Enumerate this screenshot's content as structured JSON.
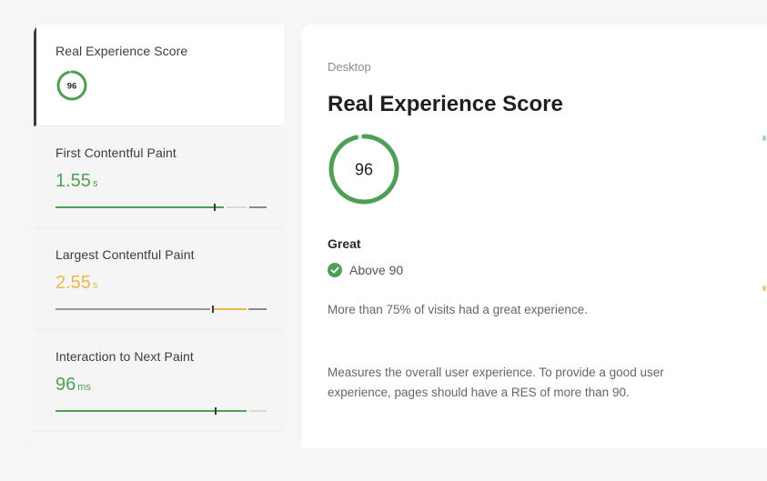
{
  "sidebar": {
    "metrics": [
      {
        "title": "Real Experience Score",
        "score": "96",
        "score_fraction": 0.96,
        "status": "good"
      },
      {
        "title": "First Contentful Paint",
        "value": "1.55",
        "unit": "s",
        "status": "good",
        "marker_fraction": 0.75
      },
      {
        "title": "Largest Contentful Paint",
        "value": "2.55",
        "unit": "s",
        "status": "needs-improvement",
        "marker_fraction": 0.74
      },
      {
        "title": "Interaction to Next Paint",
        "value": "96",
        "unit": "ms",
        "status": "good",
        "marker_fraction": 0.76
      }
    ]
  },
  "main": {
    "device": "Desktop",
    "title": "Real Experience Score",
    "score": "96",
    "score_fraction": 0.96,
    "rating": "Great",
    "threshold": "Above 90",
    "visits_text": "More than 75% of visits had a great experience.",
    "description": "Measures the overall user experience. To provide a good user experience, pages should have a RES of more than 90."
  },
  "colors": {
    "good": "#4e9f55",
    "needs_improvement": "#eab84a",
    "poor": "#8a8a8a",
    "accent_border": "#3a3a3a"
  }
}
